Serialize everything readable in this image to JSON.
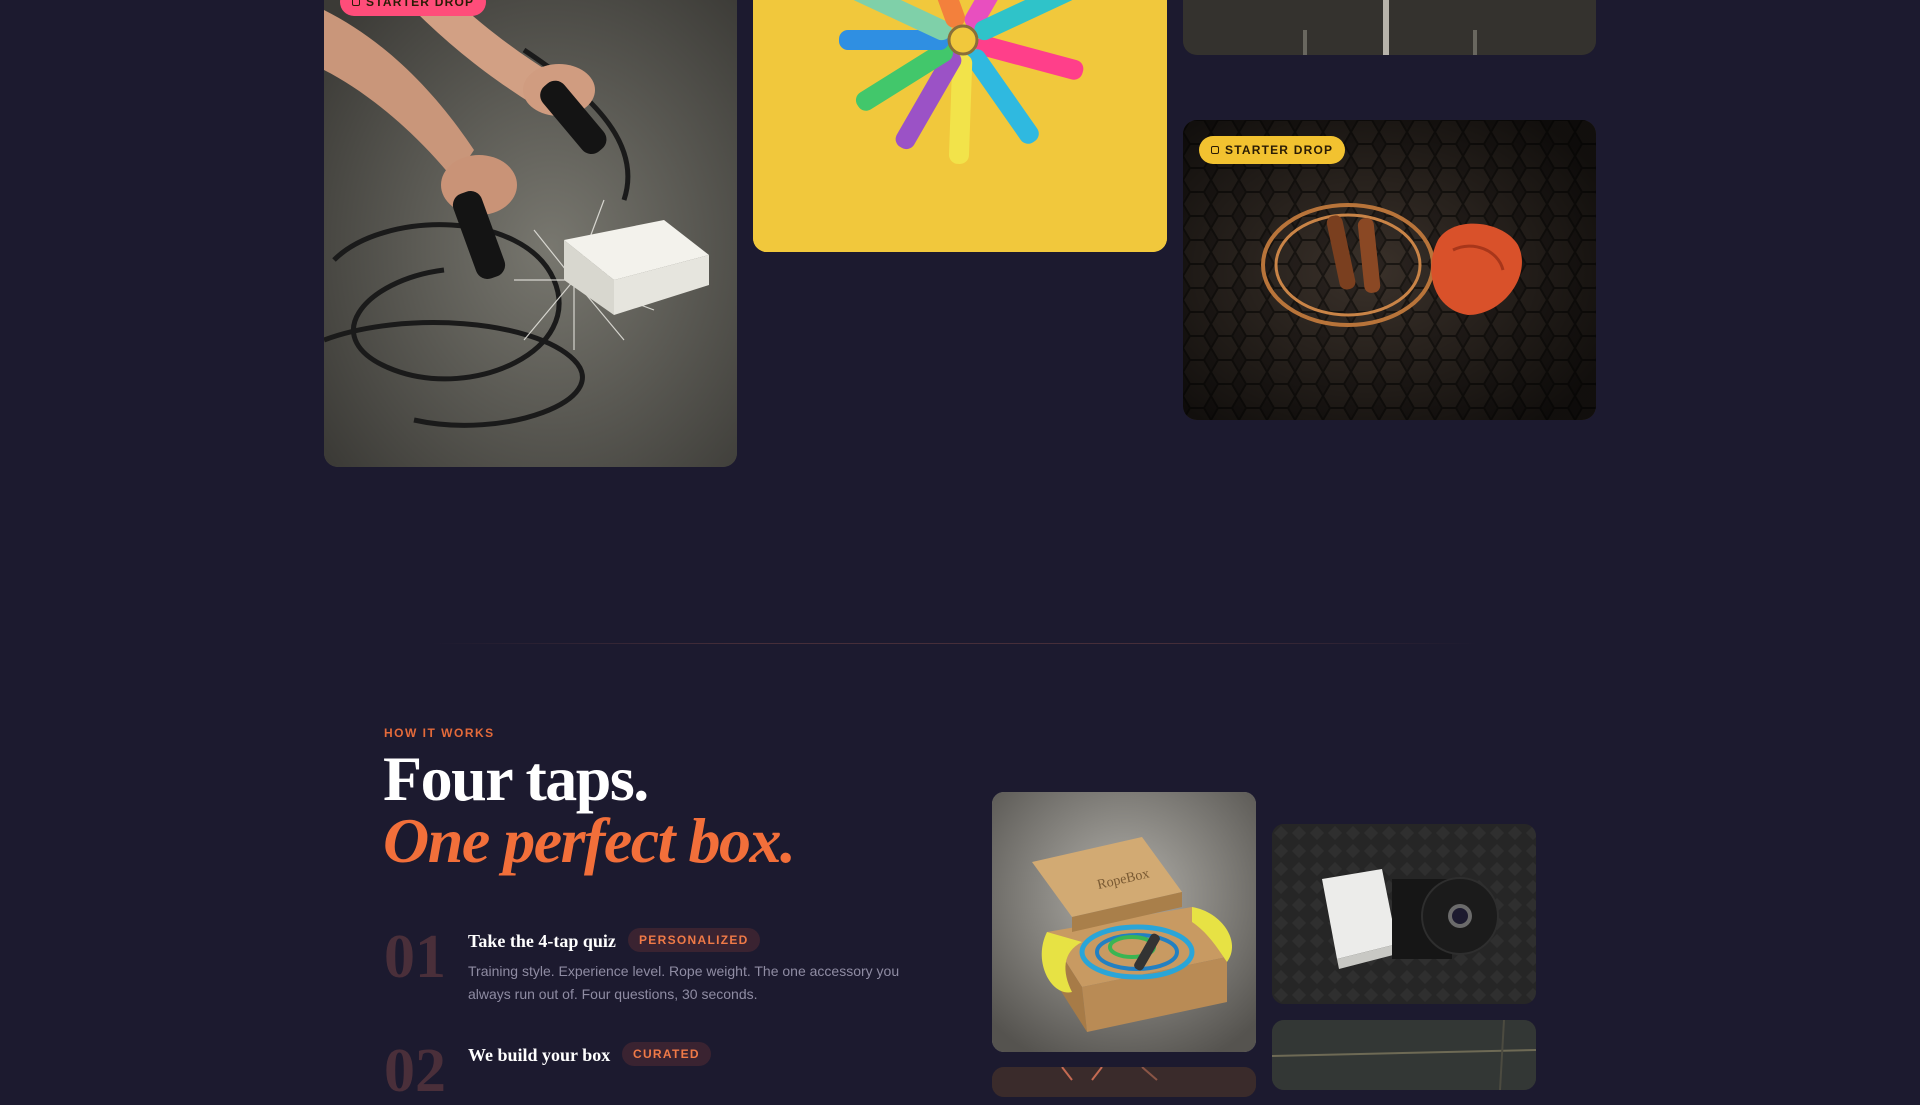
{
  "gallery": {
    "top_left_badge": "STARTER DROP",
    "starter_badge": "STARTER DROP"
  },
  "how_it_works": {
    "eyebrow": "HOW IT WORKS",
    "heading_line1": "Four taps.",
    "heading_line2": "One perfect box.",
    "steps": [
      {
        "number": "01",
        "title": "Take the 4-tap quiz",
        "tag": "PERSONALIZED",
        "description": "Training style. Experience level. Rope weight. The one accessory you always run out of. Four questions, 30 seconds."
      },
      {
        "number": "02",
        "title": "We build your box",
        "tag": "CURATED",
        "description": ""
      }
    ],
    "box_brand": "RopeBox"
  },
  "colors": {
    "background": "#1c1a2f",
    "accent": "#f26f3a",
    "badge_pink": "#ff4d7a",
    "badge_yellow": "#f2c230"
  }
}
